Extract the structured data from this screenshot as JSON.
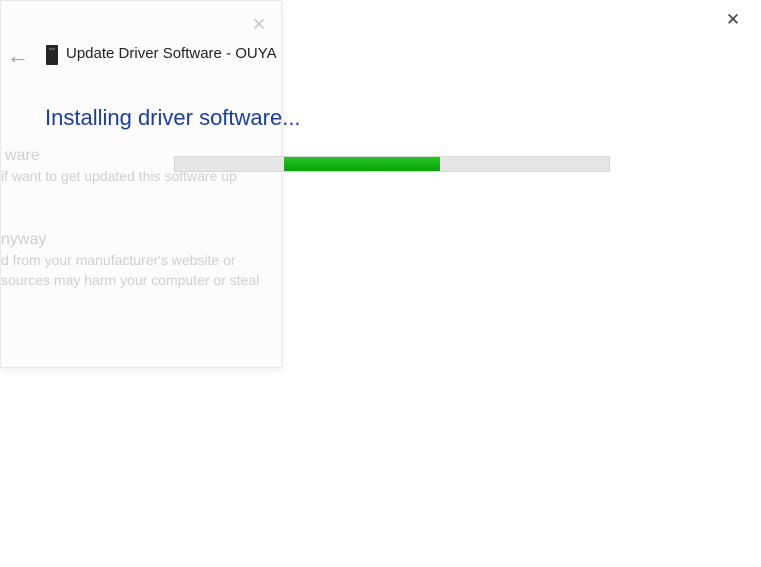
{
  "window": {
    "close_glyph": "✕"
  },
  "ghost": {
    "close_glyph": "✕",
    "line1": "ware",
    "line2": "if want to get updated this software up",
    "line3": "nyway",
    "line4": "d from your manufacturer's website or",
    "line5": "sources may harm your computer or steal"
  },
  "header": {
    "back_glyph": "←",
    "title": "Update Driver Software - OUYA"
  },
  "main": {
    "heading": "Installing driver software..."
  },
  "progress": {
    "offset_percent": 25,
    "width_percent": 36
  }
}
